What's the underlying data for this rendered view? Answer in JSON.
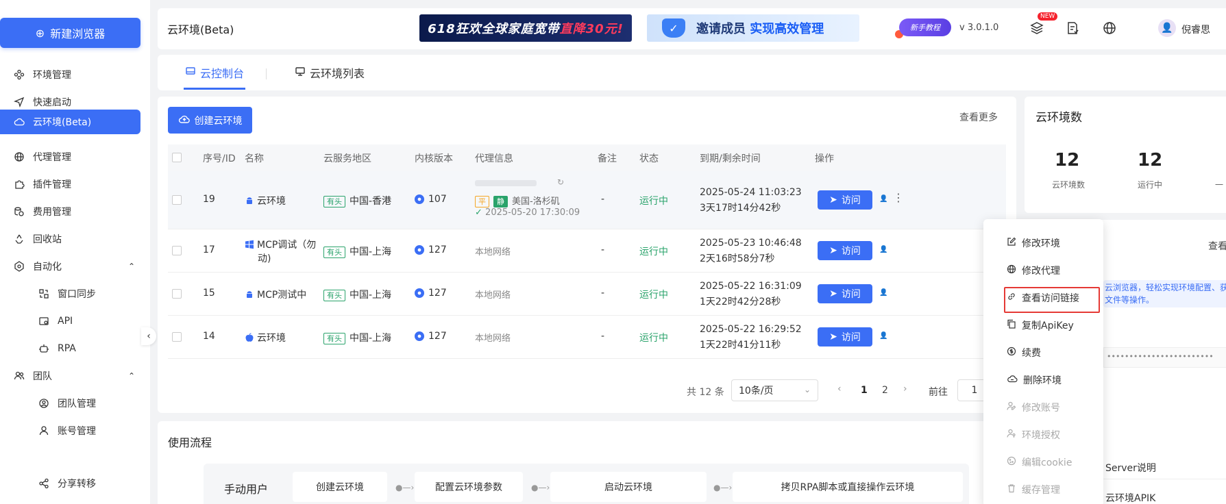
{
  "sidebar": {
    "new_button": "新建浏览器",
    "items": [
      {
        "label": "环境管理"
      },
      {
        "label": "快速启动"
      },
      {
        "label": "云环境(Beta)"
      },
      {
        "label": "代理管理"
      },
      {
        "label": "插件管理"
      },
      {
        "label": "费用管理"
      },
      {
        "label": "回收站"
      },
      {
        "label": "自动化"
      },
      {
        "label": "窗口同步"
      },
      {
        "label": "API"
      },
      {
        "label": "RPA"
      },
      {
        "label": "团队"
      },
      {
        "label": "团队管理"
      },
      {
        "label": "账号管理"
      },
      {
        "label": "分享转移"
      }
    ]
  },
  "header": {
    "title": "云环境(Beta)",
    "banner1_text": "618狂欢全球家庭宽带",
    "banner1_highlight": "直降30元!",
    "banner2_text": "邀请成员",
    "banner2_highlight": "实现高效管理",
    "tutorial": "新手教程",
    "version": "v 3.0.1.0",
    "new_badge": "NEW",
    "username": "倪睿思"
  },
  "tabs": [
    {
      "label": "云控制台",
      "active": true
    },
    {
      "label": "云环境列表",
      "active": false
    }
  ],
  "main": {
    "create_button": "创建云环境",
    "more_link": "查看更多",
    "columns": [
      "序号/ID",
      "名称",
      "云服务地区",
      "内核版本",
      "代理信息",
      "备注",
      "状态",
      "到期/剩余时间",
      "操作"
    ],
    "rows": [
      {
        "id": "19",
        "os": "android",
        "name": "云环境",
        "tag": "有头",
        "region": "中国-香港",
        "kernel": "107",
        "proxy_tag1": "平",
        "proxy_tag2": "静",
        "proxy": "美国-洛杉矶",
        "proxy_time": "2025-05-20 17:30:09",
        "note": "-",
        "status": "运行中",
        "expire": "2025-05-24 11:03:23",
        "remain": "3天17时14分42秒",
        "action": "访问"
      },
      {
        "id": "17",
        "os": "windows",
        "name": "MCP调试（勿",
        "name2": "动)",
        "tag": "有头",
        "region": "中国-上海",
        "kernel": "127",
        "proxy": "本地网络",
        "note": "-",
        "status": "运行中",
        "expire": "2025-05-23 10:46:48",
        "remain": "2天16时58分7秒",
        "action": "访问"
      },
      {
        "id": "15",
        "os": "android",
        "name": "MCP测试中",
        "tag": "有头",
        "region": "中国-上海",
        "kernel": "127",
        "proxy": "本地网络",
        "note": "-",
        "status": "运行中",
        "expire": "2025-05-22 16:31:09",
        "remain": "1天22时42分28秒",
        "action": "访问"
      },
      {
        "id": "14",
        "os": "apple",
        "name": "云环境",
        "tag": "有头",
        "region": "中国-上海",
        "kernel": "127",
        "proxy": "本地网络",
        "note": "-",
        "status": "运行中",
        "expire": "2025-05-22 16:29:52",
        "remain": "1天22时41分11秒",
        "action": "访问"
      }
    ],
    "pager": {
      "total": "共 12 条",
      "page_size": "10条/页",
      "pages": [
        "1",
        "2"
      ],
      "current": "1",
      "goto_label": "前往",
      "goto_value": "1"
    }
  },
  "usage": {
    "title": "使用流程",
    "row_label": "手动用户",
    "steps": [
      "创建云环境",
      "配置云环境参数",
      "启动云环境",
      "拷贝RPA脚本或直接操作云环境"
    ]
  },
  "right_panel": {
    "title": "云环境数",
    "stats": [
      {
        "value": "12",
        "label": "云环境数"
      },
      {
        "value": "12",
        "label": "运行中"
      }
    ],
    "partial_label": "一",
    "more": "查看",
    "desc1": "云浏览器，轻松实现环境配置、获取",
    "desc2": "文件等操作。",
    "masked": "••••••••••••••••••••••••",
    "server_note": "Server说明",
    "last_partial": "云环境APIK"
  },
  "menu": {
    "items": [
      {
        "label": "修改环境",
        "icon": "edit-icon",
        "disabled": false
      },
      {
        "label": "修改代理",
        "icon": "globe-icon",
        "disabled": false
      },
      {
        "label": "查看访问链接",
        "icon": "link-icon",
        "disabled": false
      },
      {
        "label": "复制ApiKey",
        "icon": "copy-icon",
        "disabled": false
      },
      {
        "label": "续费",
        "icon": "coin-icon",
        "disabled": false
      },
      {
        "label": "删除环境",
        "icon": "cloud-delete-icon",
        "disabled": false
      },
      {
        "label": "修改账号",
        "icon": "user-edit-icon",
        "disabled": true
      },
      {
        "label": "环境授权",
        "icon": "user-key-icon",
        "disabled": true
      },
      {
        "label": "编辑cookie",
        "icon": "cookie-icon",
        "disabled": true
      },
      {
        "label": "缓存管理",
        "icon": "trash-icon",
        "disabled": true
      }
    ],
    "highlighted_index": 2
  },
  "colors": {
    "primary": "#3b6ef5",
    "success": "#2aa36b",
    "highlight_border": "#e53935"
  }
}
